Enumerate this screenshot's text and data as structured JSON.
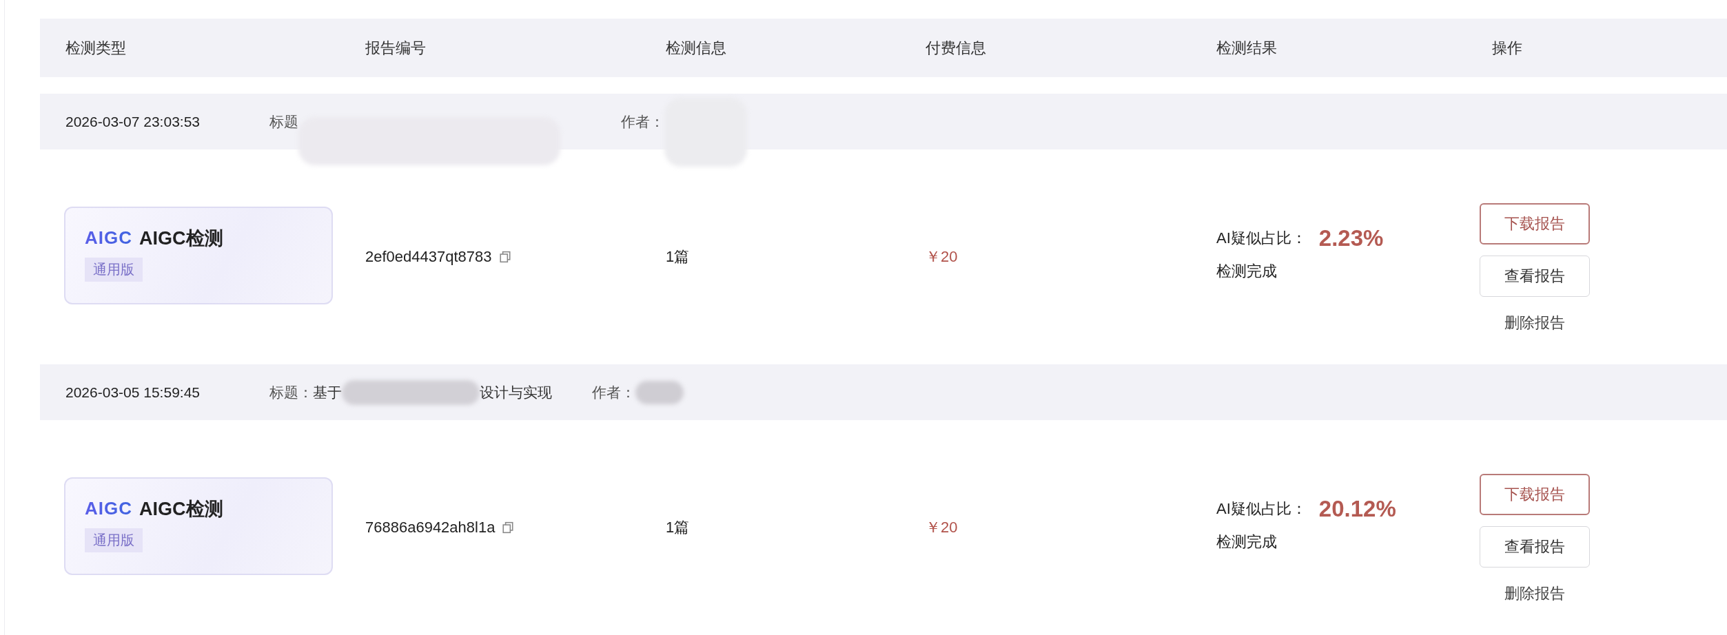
{
  "columns": [
    "检测类型",
    "报告编号",
    "检测信息",
    "付费信息",
    "检测结果",
    "操作"
  ],
  "records": [
    {
      "time": "2026-03-07 23:03:53",
      "title": {
        "label": "标题"
      },
      "author_label": "作者：",
      "type": {
        "logo": "AIGC",
        "name": "AIGC检测",
        "edition": "通用版"
      },
      "report_id": "2ef0ed4437qt8783",
      "info": "1篇",
      "price": "￥20",
      "result": {
        "label": "AI疑似占比：",
        "value": "2.23%",
        "status": "检测完成"
      },
      "actions": [
        {
          "label": "下载报告",
          "kind": "primary"
        },
        {
          "label": "查看报告",
          "kind": "outline"
        },
        {
          "label": "删除报告",
          "kind": "link"
        }
      ]
    },
    {
      "time": "2026-03-05 15:59:45",
      "title": {
        "label": "标题：",
        "prefix": "基于",
        "suffix": "设计与实现"
      },
      "author_label": "作者：",
      "type": {
        "logo": "AIGC",
        "name": "AIGC检测",
        "edition": "通用版"
      },
      "report_id": "76886a6942ah8l1a",
      "info": "1篇",
      "price": "￥20",
      "result": {
        "label": "AI疑似占比：",
        "value": "20.12%",
        "status": "检测完成"
      },
      "actions": [
        {
          "label": "下载报告",
          "kind": "primary"
        },
        {
          "label": "查看报告",
          "kind": "outline"
        },
        {
          "label": "删除报告",
          "kind": "link"
        }
      ]
    }
  ]
}
